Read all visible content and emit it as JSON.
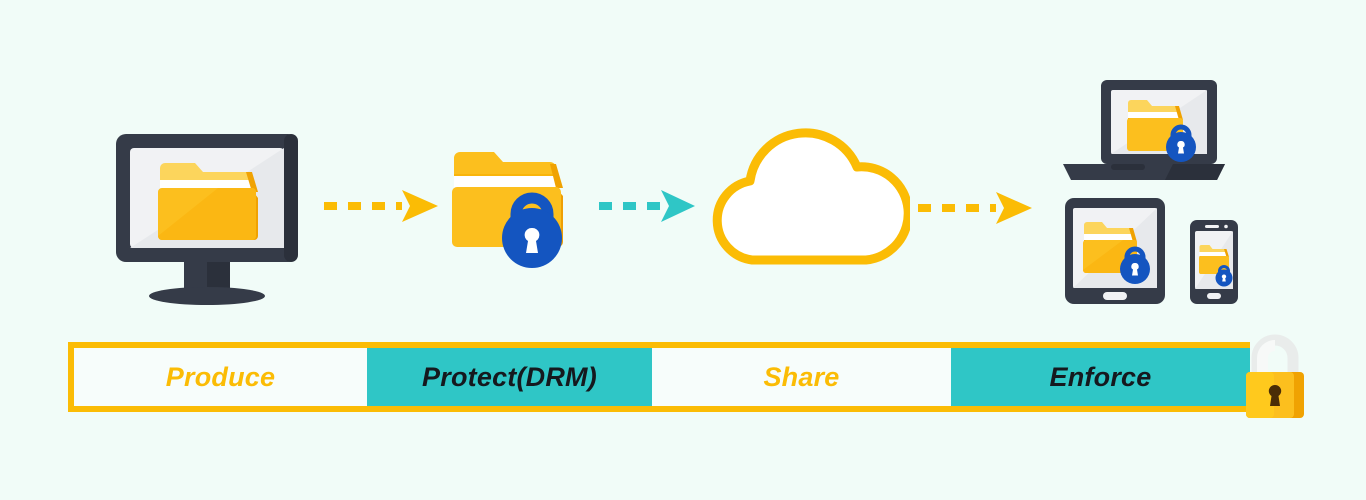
{
  "diagram": {
    "title": "DRM document lifecycle flow",
    "background_color": "#f1fcf8",
    "accent_yellow": "#fbbc05",
    "accent_teal": "#2fc6c6",
    "accent_blue": "#1455c0",
    "dark_gray": "#353b48"
  },
  "flow": {
    "steps": [
      {
        "key": "produce",
        "label": "Produce",
        "icon": "desktop-monitor-folder-icon",
        "state": "plain"
      },
      {
        "key": "protect",
        "label": "Protect(DRM)",
        "icon": "folder-with-lock-icon",
        "state": "filled"
      },
      {
        "key": "share",
        "label": "Share",
        "icon": "cloud-icon",
        "state": "plain"
      },
      {
        "key": "enforce",
        "label": "Enforce",
        "icon": "multi-device-icon",
        "state": "filled"
      }
    ],
    "connectors": [
      {
        "key": "produce-to-protect",
        "style": "dashed-arrow",
        "color": "#fbbc05"
      },
      {
        "key": "protect-to-share",
        "style": "dashed-arrow",
        "color": "#2fc6c6"
      },
      {
        "key": "share-to-enforce",
        "style": "dashed-arrow",
        "color": "#fbbc05"
      }
    ],
    "end_badge": {
      "key": "padlock",
      "icon": "padlock-icon",
      "color": "#fbbc05"
    }
  },
  "devices": [
    {
      "key": "desktop",
      "name": "desktop-monitor",
      "content": "locked-folder"
    },
    {
      "key": "laptop",
      "name": "laptop",
      "content": "locked-folder"
    },
    {
      "key": "tablet",
      "name": "tablet",
      "content": "locked-folder"
    },
    {
      "key": "phone",
      "name": "smartphone",
      "content": "locked-folder"
    }
  ]
}
